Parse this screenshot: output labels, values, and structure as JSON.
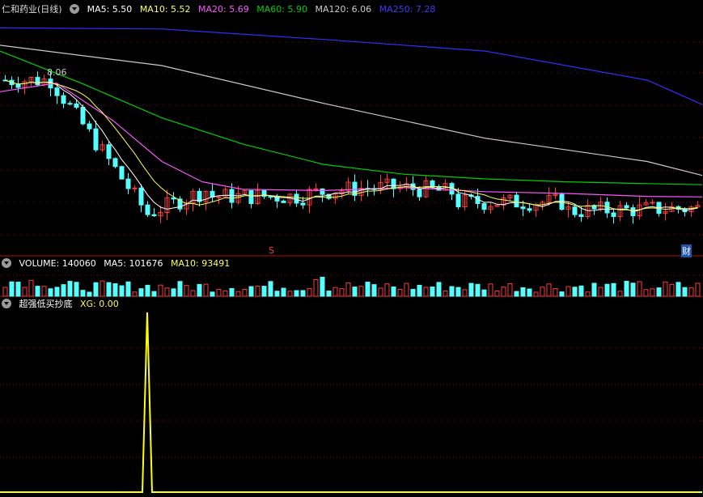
{
  "price_panel": {
    "title": "仁和药业(日线)",
    "ma5": "MA5: 5.50",
    "ma10": "MA10: 5.52",
    "ma20": "MA20: 5.69",
    "ma60": "MA60: 5.90",
    "ma120": "MA120: 6.06",
    "ma250": "MA250: 7.28",
    "peak_label": "8.06",
    "marker_s": "S",
    "marker_cai": "财"
  },
  "volume_panel": {
    "volume": "VOLUME: 140060",
    "ma5": "MA5: 101676",
    "ma10": "MA10: 93491"
  },
  "indicator_panel": {
    "name": "超强低买抄底",
    "xg": "XG: 0.00"
  },
  "colors": {
    "up": "#ff3b3b",
    "down": "#54ffff",
    "ma5": "#ffffff",
    "ma10": "#ffff55",
    "ma20": "#ff55ff",
    "ma60": "#00d000",
    "ma120": "#cccccc",
    "ma250": "#3030ff",
    "xg": "#ffff00",
    "grid": "#7a1010"
  },
  "chart_data": [
    {
      "type": "line",
      "title": "仁和药业(日线)",
      "series": [
        {
          "name": "MA250",
          "x": [
            0,
            200,
            400,
            600,
            800,
            868
          ],
          "y": [
            8.6,
            8.58,
            8.4,
            8.2,
            7.7,
            7.28
          ]
        },
        {
          "name": "MA120",
          "x": [
            0,
            200,
            400,
            600,
            800,
            868
          ],
          "y": [
            8.3,
            7.95,
            7.3,
            6.7,
            6.3,
            6.06
          ]
        },
        {
          "name": "MA60",
          "x": [
            0,
            100,
            200,
            300,
            400,
            500,
            600,
            700,
            800,
            868
          ],
          "y": [
            8.2,
            7.65,
            7.05,
            6.6,
            6.25,
            6.08,
            6.0,
            5.95,
            5.92,
            5.9
          ]
        },
        {
          "name": "MA20",
          "x": [
            0,
            70,
            140,
            200,
            250,
            300,
            400,
            500,
            600,
            700,
            800,
            868
          ],
          "y": [
            7.5,
            7.65,
            7.0,
            6.3,
            5.95,
            5.82,
            5.8,
            5.85,
            5.78,
            5.75,
            5.7,
            5.69
          ]
        }
      ]
    },
    {
      "type": "line",
      "title": "超强低买抄底",
      "series": [
        {
          "name": "XG",
          "x": [
            0,
            176,
            182,
            188,
            868
          ],
          "y": [
            0,
            0,
            1,
            0,
            0
          ]
        }
      ]
    }
  ]
}
